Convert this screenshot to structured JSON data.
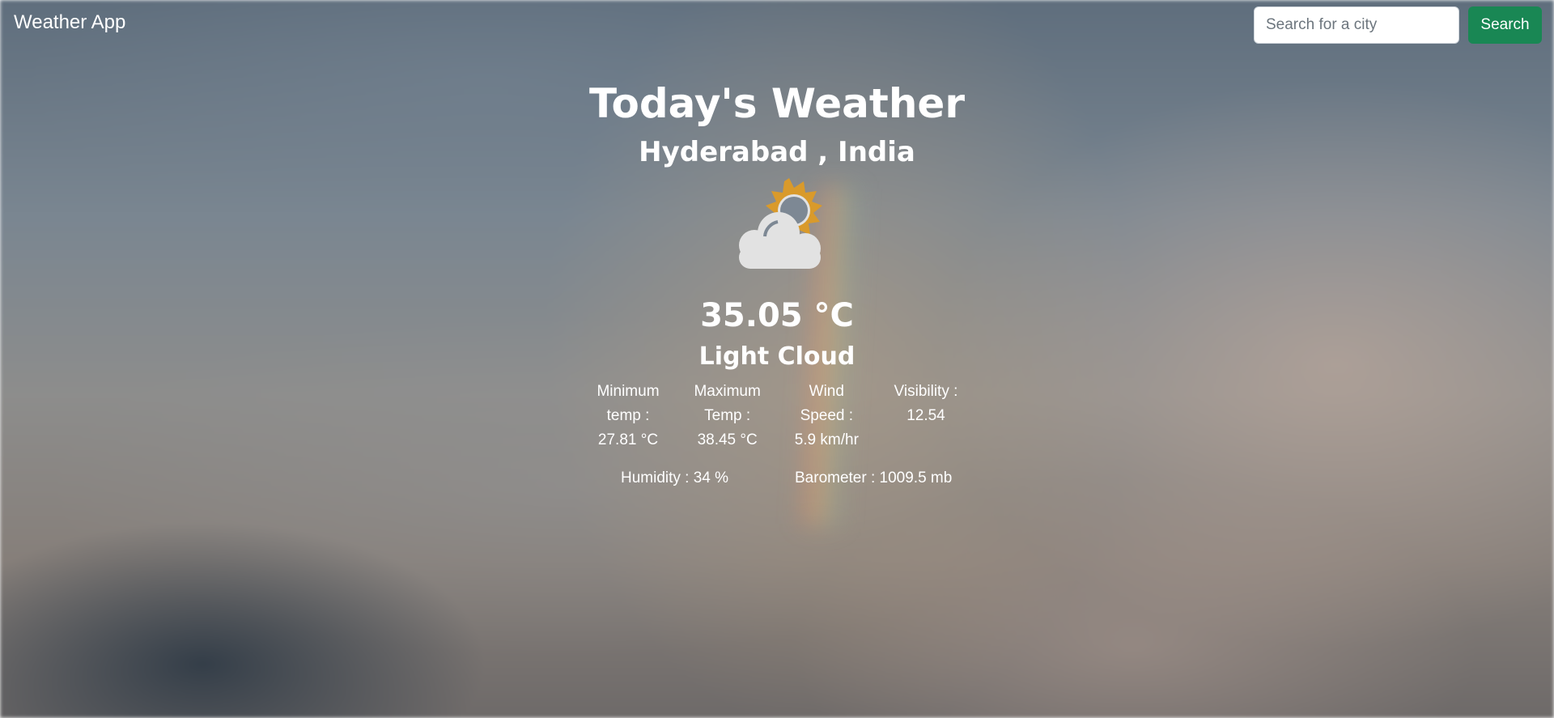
{
  "navbar": {
    "brand": "Weather App",
    "search_placeholder": "Search for a city",
    "search_value": "",
    "search_button": "Search"
  },
  "main": {
    "title": "Today's Weather",
    "location": "Hyderabad , India",
    "icon": "partly-cloudy-icon",
    "temperature": "35.05 °C",
    "condition": "Light Cloud",
    "stats": [
      {
        "label_line1": "Minimum",
        "label_line2": "temp :",
        "value": "27.81 °C"
      },
      {
        "label_line1": "Maximum",
        "label_line2": "Temp :",
        "value": "38.45 °C"
      },
      {
        "label_line1": "Wind",
        "label_line2": "Speed :",
        "value": "5.9 km/hr"
      },
      {
        "label_line1": "Visibility :",
        "label_line2": "12.54",
        "value": ""
      }
    ],
    "humidity": "Humidity : 34 %",
    "barometer": "Barometer : 1009.5 mb"
  },
  "colors": {
    "search_button_bg": "#198754",
    "sun": "#d99a2b",
    "cloud": "#e2e2e2"
  }
}
